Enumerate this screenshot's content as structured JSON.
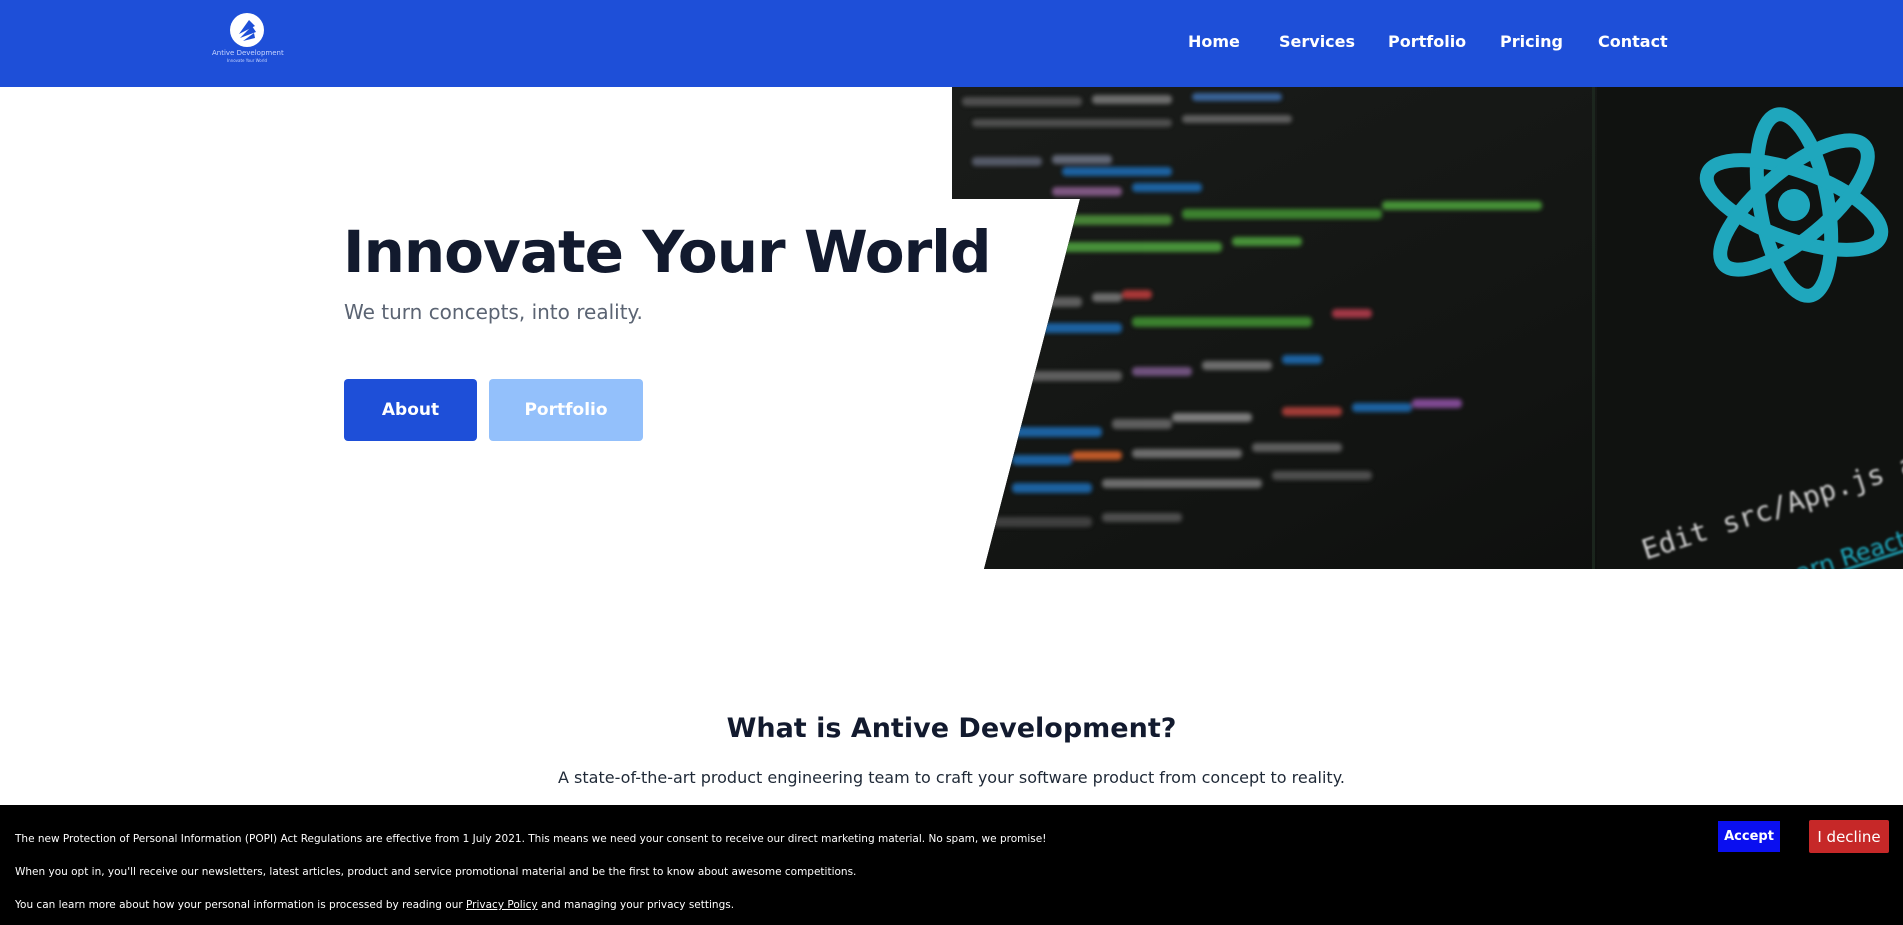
{
  "brand": {
    "name": "Antive Development",
    "tagline": "Innovate Your World"
  },
  "nav": {
    "items": [
      {
        "label": "Home"
      },
      {
        "label": "Services"
      },
      {
        "label": "Portfolio"
      },
      {
        "label": "Pricing"
      },
      {
        "label": "Contact"
      }
    ]
  },
  "hero": {
    "title": "Innovate Your World",
    "subtitle": "We turn concepts, into reality.",
    "primary_button": "About",
    "secondary_button": "Portfolio",
    "image_overlay": {
      "edit_text": "Edit src/App.js and save to",
      "link_text": "Learn React"
    }
  },
  "about": {
    "title": "What is Antive Development?",
    "text": "A state-of-the-art product engineering team to craft your software product from concept to reality."
  },
  "cookie": {
    "line1": "The new Protection of Personal Information (POPI) Act Regulations are effective from 1 July 2021. This means we need your consent to receive our direct marketing material. No spam, we promise!",
    "line2": "When you opt in, you'll receive our newsletters, latest articles, product and service promotional material and be the first to know about awesome competitions.",
    "line3_prefix": "You can learn more about how your personal information is processed by reading our",
    "privacy_link": "Privacy Policy",
    "line3_suffix": "and managing your privacy settings.",
    "accept_label": "Accept",
    "decline_label": "I decline"
  },
  "colors": {
    "header": "#1e4fd8",
    "primary_button": "#1e4fd8",
    "secondary_button": "#93c0fb",
    "accept": "#0a0ff0",
    "decline": "#c62828",
    "react_cyan": "#1fa7bd"
  }
}
